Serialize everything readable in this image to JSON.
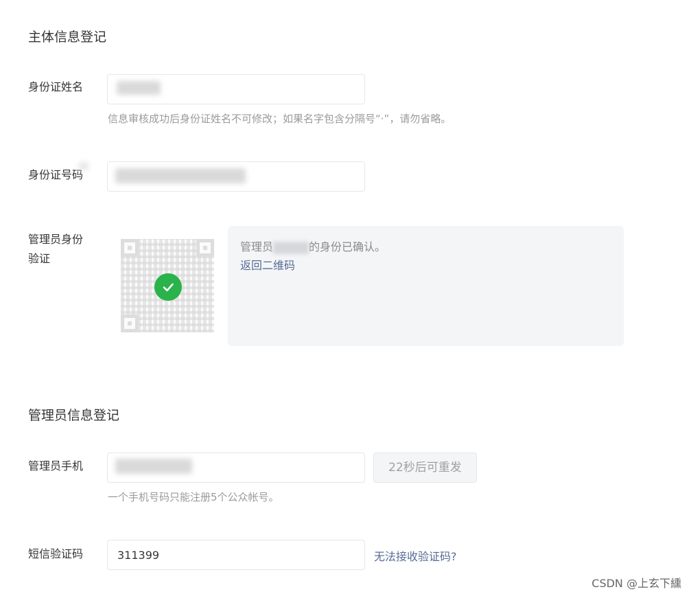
{
  "entity_section": {
    "title": "主体信息登记",
    "id_name": {
      "label": "身份证姓名",
      "value": "",
      "hint": "信息审核成功后身份证姓名不可修改；如果名字包含分隔号“·”，请勿省略。"
    },
    "id_number": {
      "label": "身份证号码",
      "value": ""
    },
    "admin_verification": {
      "label_line1": "管理员身份",
      "label_line2": "验证",
      "status_prefix": "管理员",
      "status_suffix": "的身份已确认。",
      "back_link": "返回二维码",
      "icons": {
        "qr": "qr-code-icon",
        "check": "check-circle-icon"
      },
      "check_color": "#2ab24b"
    }
  },
  "admin_section": {
    "title": "管理员信息登记",
    "phone": {
      "label": "管理员手机",
      "value": "",
      "resend_button": "22秒后可重发",
      "hint": "一个手机号码只能注册5个公众帐号。"
    },
    "sms_code": {
      "label": "短信验证码",
      "value": "311399",
      "help_link": "无法接收验证码?"
    }
  },
  "watermark": "CSDN @上玄下纁",
  "colors": {
    "link": "#576b95",
    "text": "#353535",
    "hint": "#9a9a9a",
    "panel_bg": "#f4f5f7"
  }
}
